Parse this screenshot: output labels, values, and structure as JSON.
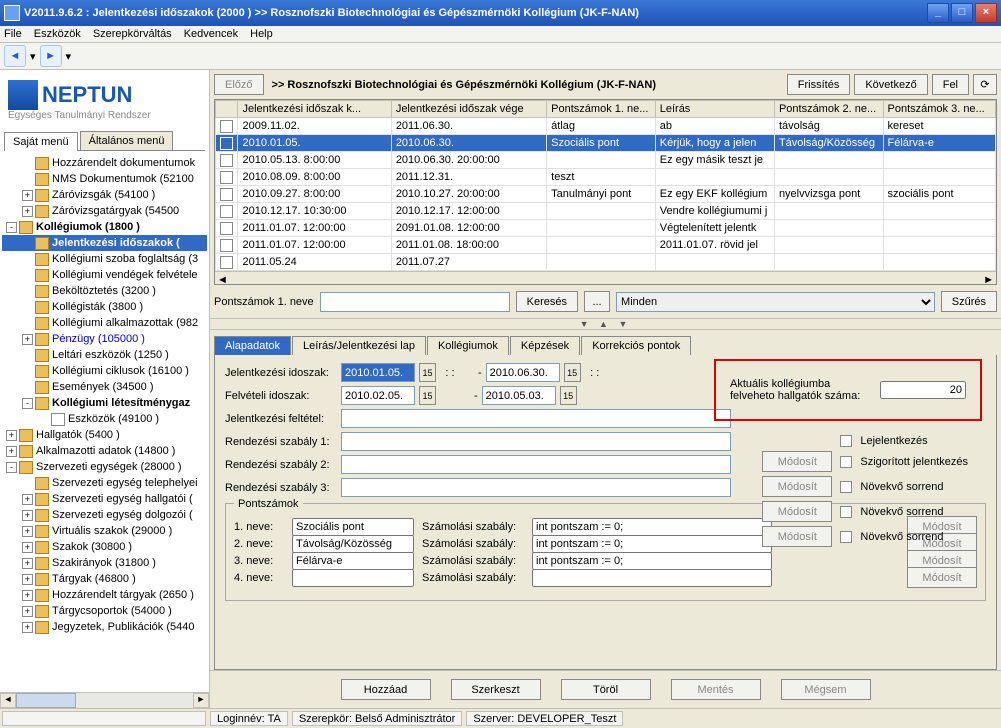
{
  "window": {
    "title": "V2011.9.6.2 : Jelentkezési időszakok (2000 )   >> Rosznofszki Biotechnológiai és Gépészmérnöki Kollégium (JK-F-NAN)"
  },
  "menubar": [
    "File",
    "Eszközök",
    "Szerepkörváltás",
    "Kedvencek",
    "Help"
  ],
  "logo": {
    "brand": "NEPTUN",
    "sub": "Egységes Tanulmányi Rendszer"
  },
  "sidetabs": {
    "active": "Saját menü",
    "other": "Általános menü"
  },
  "tree": [
    {
      "d": 1,
      "exp": "",
      "label": "Hozzárendelt dokumentumok"
    },
    {
      "d": 1,
      "exp": "",
      "label": "NMS Dokumentumok (52100"
    },
    {
      "d": 1,
      "exp": "+",
      "label": "Záróvizsgák (54100 )"
    },
    {
      "d": 1,
      "exp": "+",
      "label": "Záróvizsgatárgyak (54500"
    },
    {
      "d": 0,
      "exp": "-",
      "label": "Kollégiumok (1800 )",
      "bold": true
    },
    {
      "d": 1,
      "exp": "",
      "label": "Jelentkezési időszakok (",
      "bold": true,
      "sel": true
    },
    {
      "d": 1,
      "exp": "",
      "label": "Kollégiumi szoba foglaltság (3"
    },
    {
      "d": 1,
      "exp": "",
      "label": "Kollégiumi vendégek felvétele"
    },
    {
      "d": 1,
      "exp": "",
      "label": "Beköltöztetés (3200 )"
    },
    {
      "d": 1,
      "exp": "",
      "label": "Kollégisták (3800 )"
    },
    {
      "d": 1,
      "exp": "",
      "label": "Kollégiumi alkalmazottak (982"
    },
    {
      "d": 1,
      "exp": "+",
      "label": "Pénzügy (105000 )",
      "blue": true
    },
    {
      "d": 1,
      "exp": "",
      "label": "Leltári eszközök (1250 )"
    },
    {
      "d": 1,
      "exp": "",
      "label": "Kollégiumi ciklusok (16100 )"
    },
    {
      "d": 1,
      "exp": "",
      "label": "Események (34500 )"
    },
    {
      "d": 1,
      "exp": "-",
      "label": "Kollégiumi létesítménygaz",
      "bold": true
    },
    {
      "d": 2,
      "exp": "",
      "label": "Eszközök (49100 )",
      "doc": true
    },
    {
      "d": 0,
      "exp": "+",
      "label": "Hallgatók (5400 )"
    },
    {
      "d": 0,
      "exp": "+",
      "label": "Alkalmazotti adatok (14800 )"
    },
    {
      "d": 0,
      "exp": "-",
      "label": "Szervezeti egységek (28000 )"
    },
    {
      "d": 1,
      "exp": "",
      "label": "Szervezeti egység telephelyei"
    },
    {
      "d": 1,
      "exp": "+",
      "label": "Szervezeti egység hallgatói ("
    },
    {
      "d": 1,
      "exp": "+",
      "label": "Szervezeti egység dolgozói ("
    },
    {
      "d": 1,
      "exp": "+",
      "label": "Virtuális szakok (29000 )"
    },
    {
      "d": 1,
      "exp": "+",
      "label": "Szakok (30800 )"
    },
    {
      "d": 1,
      "exp": "+",
      "label": "Szakirányok (31800 )"
    },
    {
      "d": 1,
      "exp": "+",
      "label": "Tárgyak (46800 )"
    },
    {
      "d": 1,
      "exp": "+",
      "label": "Hozzárendelt tárgyak (2650 )"
    },
    {
      "d": 1,
      "exp": "+",
      "label": "Tárgycsoportok (54000 )"
    },
    {
      "d": 1,
      "exp": "+",
      "label": "Jegyzetek, Publikációk (5440"
    }
  ],
  "top": {
    "prev": "Előző",
    "heading": ">> Rosznofszki Biotechnológiai és Gépészmérnöki Kollégium (JK-F-NAN)",
    "refresh": "Frissítés",
    "next": "Következő",
    "up": "Fel"
  },
  "grid": {
    "headers": [
      "",
      "Jelentkezési időszak k...",
      "Jelentkezési időszak vége",
      "Pontszámok 1. ne...",
      "Leírás",
      "Pontszámok 2. ne...",
      "Pontszámok 3. ne..."
    ],
    "rows": [
      [
        "",
        "2009.11.02.",
        "2011.06.30.",
        "átlag",
        "ab",
        "távolság",
        "kereset"
      ],
      [
        "",
        "2010.01.05.",
        "2010.06.30.",
        "Szociális pont",
        "Kérjük, hogy a jelen",
        "Távolság/Közösség",
        "Félárva-e"
      ],
      [
        "",
        "2010.05.13. 8:00:00",
        "2010.06.30. 20:00:00",
        "",
        "Ez egy másik teszt je",
        "",
        ""
      ],
      [
        "",
        "2010.08.09. 8:00:00",
        "2011.12.31.",
        "teszt",
        "",
        "",
        ""
      ],
      [
        "",
        "2010.09.27. 8:00:00",
        "2010.10.27. 20:00:00",
        "Tanulmányi pont",
        "Ez egy EKF kollégium",
        "nyelvvizsga pont",
        "szociális pont"
      ],
      [
        "",
        "2010.12.17. 10:30:00",
        "2010.12.17. 12:00:00",
        "",
        "Vendre kollégiumumi j",
        "",
        ""
      ],
      [
        "",
        "2011.01.07. 12:00:00",
        "2091.01.08. 12:00:00",
        "",
        "Végtelenített jelentk",
        "",
        ""
      ],
      [
        "",
        "2011.01.07. 12:00:00",
        "2011.01.08. 18:00:00",
        "",
        "2011.01.07. rövid jel",
        "",
        ""
      ],
      [
        "",
        "2011.05.24",
        "2011.07.27",
        "",
        "",
        "",
        ""
      ]
    ],
    "sel": 1
  },
  "filter": {
    "label": "Pontszámok 1. neve",
    "search": "Keresés",
    "all": "Minden",
    "apply": "Szűrés",
    "dots": "..."
  },
  "tabs": [
    "Alapadatok",
    "Leírás/Jelentkezési lap",
    "Kollégiumok",
    "Képzések",
    "Korrekciós pontok"
  ],
  "form": {
    "jel_idoszak": "Jelentkezési idoszak:",
    "jel_from": "2010.01.05.",
    "jel_to": "2010.06.30.",
    "felv_idoszak": "Felvételi idoszak:",
    "felv_from": "2010.02.05.",
    "felv_to": "2010.05.03.",
    "feltetel": "Jelentkezési feltétel:",
    "r1": "Rendezési szabály 1:",
    "r2": "Rendezési szabály 2:",
    "r3": "Rendezési szabály 3:",
    "red_label": "Aktuális kollégiumba felveheto hallgatók száma:",
    "red_value": "20",
    "lejel": "Lejelentkezés",
    "modosit": "Módosít",
    "szig": "Szigorított jelentkezés",
    "nov": "Növekvő sorrend",
    "pont_legend": "Pontszámok",
    "p_labels": [
      "1. neve:",
      "2. neve:",
      "3. neve:",
      "4. neve:"
    ],
    "p_vals": [
      "Szociális pont",
      "Távolság/Közösség",
      "Félárva-e",
      ""
    ],
    "s_label": "Számolási szabály:",
    "s_vals": [
      "int pontszam := 0;",
      "int pontszam := 0;",
      "int pontszam := 0;",
      ""
    ]
  },
  "bottom": {
    "add": "Hozzáad",
    "edit": "Szerkeszt",
    "del": "Töröl",
    "save": "Mentés",
    "cancel": "Mégsem"
  },
  "status": {
    "login": "Loginnév: TA",
    "role": "Szerepkör: Belső Adminisztrátor",
    "server": "Szerver: DEVELOPER_Teszt"
  }
}
